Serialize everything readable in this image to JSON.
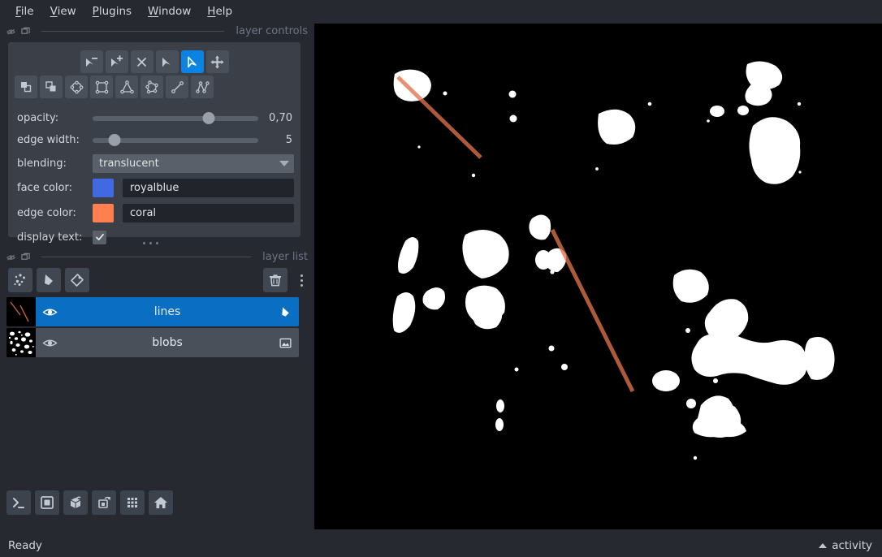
{
  "app": {
    "background": "#262930",
    "accent": "#0a84e2",
    "panel": "#3b4048"
  },
  "menubar": {
    "items": [
      {
        "name": "file",
        "label": "File",
        "mnemonic": "F"
      },
      {
        "name": "view",
        "label": "View",
        "mnemonic": "V"
      },
      {
        "name": "plugins",
        "label": "Plugins",
        "mnemonic": "P"
      },
      {
        "name": "window",
        "label": "Window",
        "mnemonic": "W"
      },
      {
        "name": "help",
        "label": "Help",
        "mnemonic": "H"
      }
    ]
  },
  "docks": {
    "layer_controls": {
      "title": "layer controls",
      "tools_row1": [
        {
          "name": "vertex-remove-tool",
          "icon": "cursor-minus-icon",
          "active": false
        },
        {
          "name": "vertex-insert-tool",
          "icon": "cursor-plus-icon",
          "active": false
        },
        {
          "name": "delete-shape-tool",
          "icon": "close-x-icon",
          "active": false
        },
        {
          "name": "select-shapes-tool",
          "icon": "cursor-filled-icon",
          "active": false
        },
        {
          "name": "direct-select-tool",
          "icon": "cursor-outline-icon",
          "active": true
        },
        {
          "name": "pan-zoom-tool",
          "icon": "move-arrows-icon",
          "active": false
        }
      ],
      "tools_row2": [
        {
          "name": "move-front-tool",
          "icon": "move-front-icon",
          "active": false
        },
        {
          "name": "move-back-tool",
          "icon": "move-back-icon",
          "active": false
        },
        {
          "name": "add-ellipse-tool",
          "icon": "ellipse-icon",
          "active": false
        },
        {
          "name": "add-rectangle-tool",
          "icon": "rectangle-icon",
          "active": false
        },
        {
          "name": "add-polygon-tool",
          "icon": "triangle-polygon-icon",
          "active": false
        },
        {
          "name": "add-polygon-lasso-tool",
          "icon": "polygon-lasso-icon",
          "active": false
        },
        {
          "name": "add-line-tool",
          "icon": "line-icon",
          "active": false
        },
        {
          "name": "add-path-tool",
          "icon": "path-icon",
          "active": false
        }
      ],
      "opacity": {
        "label": "opacity:",
        "value": "0,70",
        "percent": 70
      },
      "edge_width": {
        "label": "edge width:",
        "value": "5",
        "percent": 13
      },
      "blending": {
        "label": "blending:",
        "value": "translucent"
      },
      "face_color": {
        "label": "face color:",
        "value": "royalblue",
        "hex": "#4169e1"
      },
      "edge_color": {
        "label": "edge color:",
        "value": "coral",
        "hex": "#ff7f50"
      },
      "display_text": {
        "label": "display text:",
        "checked": true
      }
    },
    "layer_list": {
      "title": "layer list",
      "buttons": [
        {
          "name": "new-points-layer-button",
          "icon": "points-icon"
        },
        {
          "name": "new-shapes-layer-button",
          "icon": "shapes-icon"
        },
        {
          "name": "new-labels-layer-button",
          "icon": "labels-tag-icon"
        },
        {
          "name": "delete-layer-button",
          "icon": "trash-icon"
        }
      ],
      "layers": [
        {
          "name": "lines",
          "type": "shapes",
          "visible": true,
          "selected": true
        },
        {
          "name": "blobs",
          "type": "image",
          "visible": true,
          "selected": false
        }
      ]
    }
  },
  "bottom_toolbar": [
    {
      "name": "console-button",
      "icon": "console-icon"
    },
    {
      "name": "ndisplay-toggle-button",
      "icon": "square-2d-icon"
    },
    {
      "name": "ndisplay-3d-button",
      "icon": "cube-3d-icon"
    },
    {
      "name": "roll-dims-button",
      "icon": "roll-dims-icon"
    },
    {
      "name": "transpose-dims-button",
      "icon": "grid-icon"
    },
    {
      "name": "reset-view-button",
      "icon": "home-icon"
    }
  ],
  "statusbar": {
    "status": "Ready",
    "activity_label": "activity"
  },
  "canvas": {
    "background": "#000000",
    "blob_color": "#ffffff",
    "line_color": "#c1603f",
    "line_highlight_color": "#f5b9a0"
  }
}
